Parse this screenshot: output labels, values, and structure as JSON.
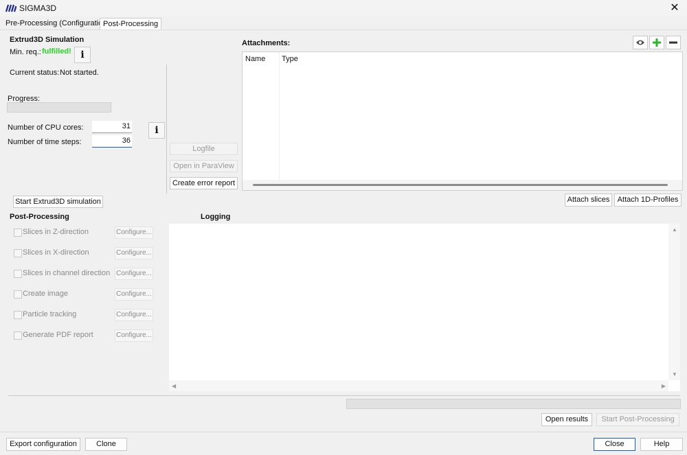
{
  "window": {
    "title": "SIGMA3D"
  },
  "tabs": [
    {
      "label": "Pre-Processing (Configuration)"
    },
    {
      "label": "Post-Processing"
    }
  ],
  "simulation": {
    "heading": "Extrud3D Simulation",
    "min_req_label": "Min. req.:",
    "min_req_value": "fulfilled!",
    "status_label": "Current status:",
    "status_value": "Not started.",
    "progress_label": "Progress:",
    "progress_fraction": 0,
    "cpu_label": "Number of CPU cores:",
    "cpu_value": "31",
    "steps_label": "Number of time steps:",
    "steps_value": "36",
    "start_button": "Start Extrud3D simulation"
  },
  "middle_buttons": {
    "logfile": "Logfile",
    "paraview": "Open in ParaView",
    "error_report": "Create error report"
  },
  "attachments": {
    "heading": "Attachments:",
    "columns": [
      "Name",
      "Type"
    ],
    "attach_slices": "Attach slices",
    "attach_profiles": "Attach 1D-Profiles"
  },
  "post_processing": {
    "heading": "Post-Processing",
    "configure_label": "Configure...",
    "items": [
      {
        "label": "Slices in Z-direction"
      },
      {
        "label": "Slices in X-direction"
      },
      {
        "label": "Slices in channel direction"
      },
      {
        "label": "Create image"
      },
      {
        "label": "Particle tracking"
      },
      {
        "label": "Generate PDF report"
      }
    ]
  },
  "logging": {
    "heading": "Logging"
  },
  "bottom": {
    "open_results": "Open results",
    "start_post": "Start Post-Processing",
    "export_config": "Export configuration",
    "clone": "Clone",
    "close": "Close",
    "help": "Help"
  },
  "colors": {
    "fulfilled": "#28d228",
    "plus": "#2db52d",
    "focus": "#1a5fb4"
  }
}
